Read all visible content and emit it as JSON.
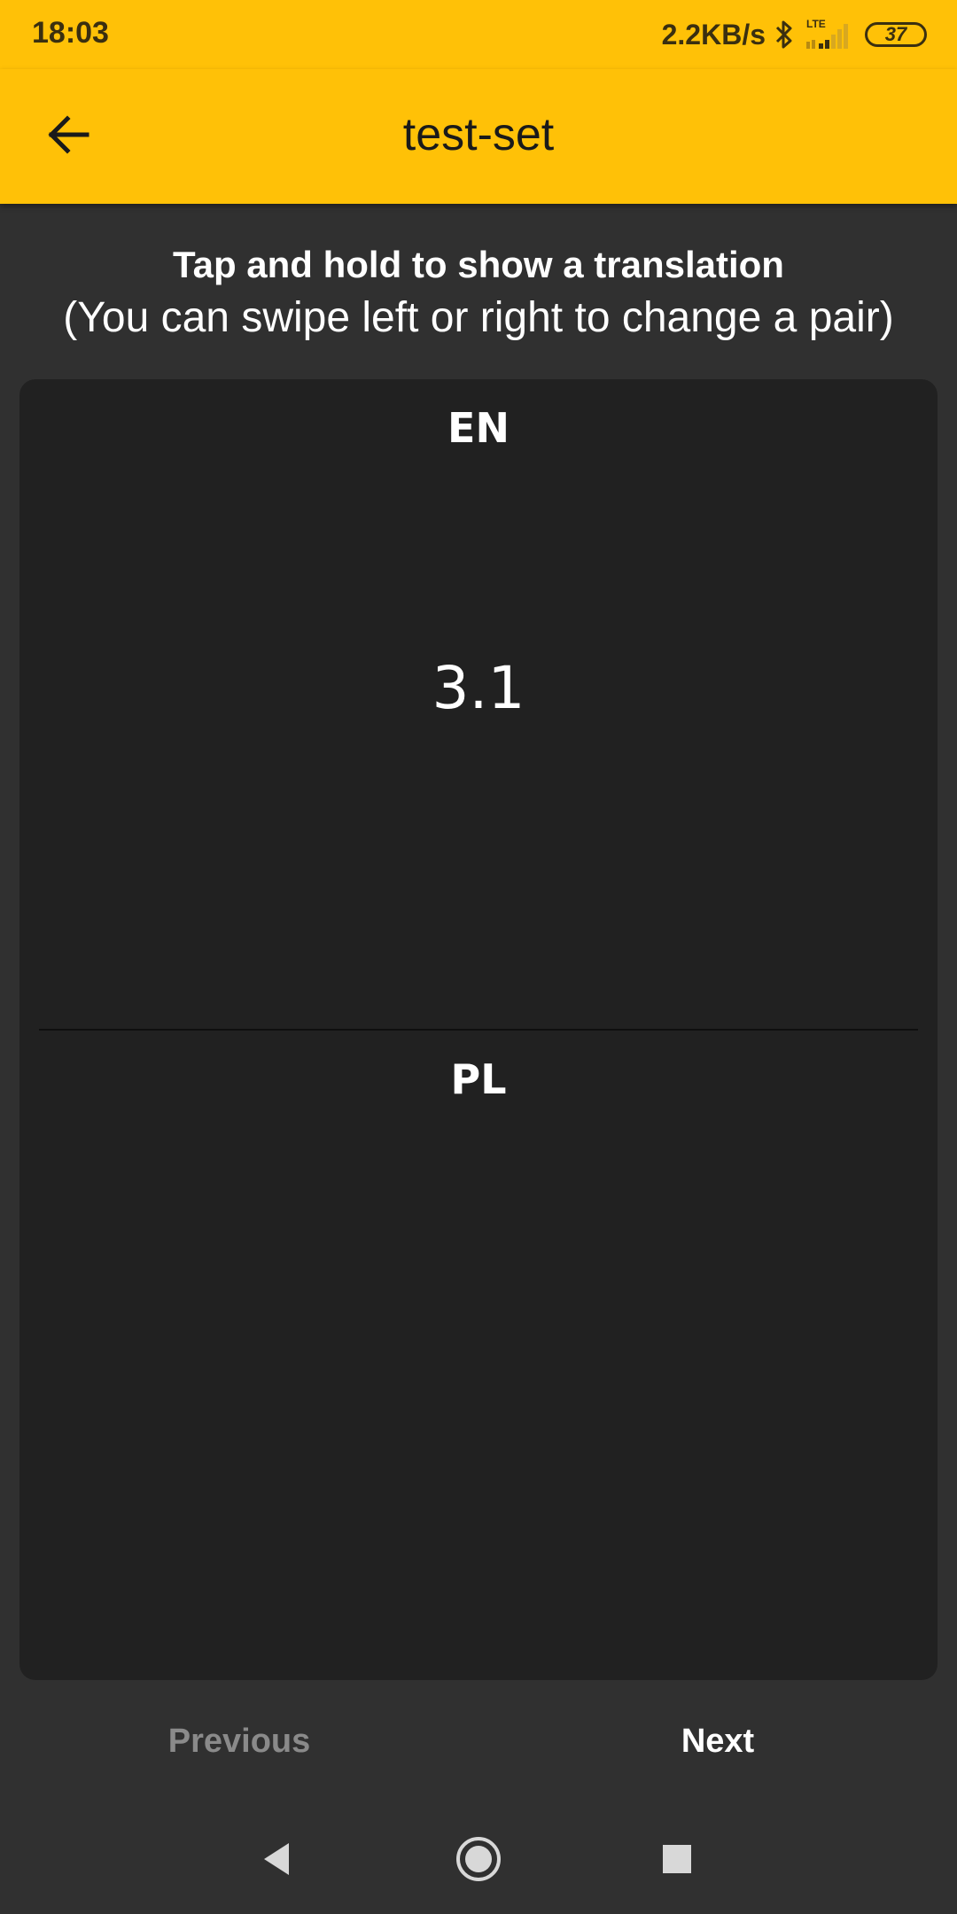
{
  "status_bar": {
    "time": "18:03",
    "network_speed": "2.2KB/s",
    "network_type": "LTE",
    "battery": "37"
  },
  "app_bar": {
    "title": "test-set",
    "back_icon": "arrow-back-icon"
  },
  "instructions": {
    "line1": "Tap and hold to show a translation",
    "line2": "(You can swipe left or right to change a pair)"
  },
  "card": {
    "source_language": "EN",
    "source_word": "3.1",
    "target_language": "PL",
    "target_word": ""
  },
  "navigation": {
    "previous_label": "Previous",
    "next_label": "Next",
    "previous_enabled": false,
    "next_enabled": true
  },
  "system_nav": {
    "back_icon": "triangle-back-icon",
    "home_icon": "circle-home-icon",
    "recents_icon": "square-recents-icon"
  },
  "colors": {
    "accent": "#FFC107",
    "background": "#303030",
    "card": "#212121",
    "text": "#FFFFFF",
    "disabled_text": "#8A8A8A"
  }
}
